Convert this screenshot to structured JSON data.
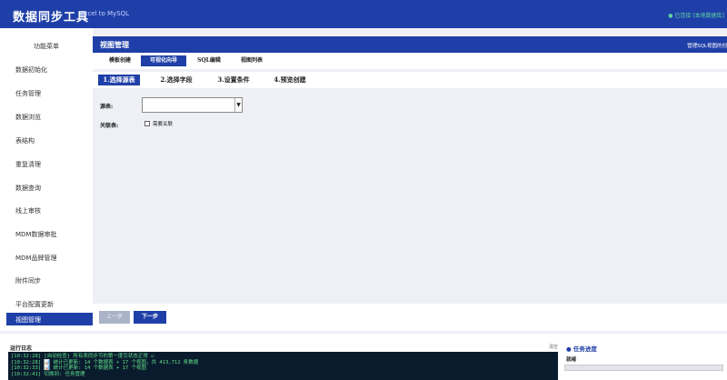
{
  "header": {
    "title": "数据同步工具",
    "subtitle": "Excel to MySQL",
    "connection_status": "● 已连接 [本地数据库]"
  },
  "sidebar": {
    "title": "功能菜单",
    "items": [
      {
        "label": "数据初始化"
      },
      {
        "label": "任务管理"
      },
      {
        "label": "数据浏览"
      },
      {
        "label": "表结构"
      },
      {
        "label": "重复清理"
      },
      {
        "label": "数据查询"
      },
      {
        "label": "线上审核"
      },
      {
        "label": "MDM数据审批"
      },
      {
        "label": "MDM品牌管理"
      },
      {
        "label": "附件同步"
      },
      {
        "label": "平台配置更新"
      },
      {
        "label": "视图管理"
      }
    ]
  },
  "main": {
    "title": "视图管理",
    "hint": "管理SQL视图的创",
    "tabs": [
      {
        "label": "模板创建"
      },
      {
        "label": "可视化向导"
      },
      {
        "label": "SQL编辑"
      },
      {
        "label": "视图列表"
      }
    ],
    "steps": [
      {
        "label": "1.选择源表"
      },
      {
        "label": "2.选择字段"
      },
      {
        "label": "3.设置条件"
      },
      {
        "label": "4.预览创建"
      }
    ],
    "form": {
      "source_label": "源表:",
      "source_value": "",
      "join_label": "关联表:",
      "join_checkbox_label": "需要关联"
    },
    "buttons": {
      "prev": "上一步",
      "next": "下一步"
    }
  },
  "log": {
    "title": "运行日志",
    "clear": "清空",
    "lines": [
      "[10:32:28] [自动检查] 所有表同步节的第一度引状态正常 ☑",
      "[10:32:28] 📊 统计已更新: 14 个数据表 + 17 个视图，共 413,712 条数据",
      "[10:32:33] 📊 统计已更新: 14 个数据表 + 17 个视图",
      "[10:32:41] 切换到: 任务管理"
    ]
  },
  "progress": {
    "title": "● 任务进度",
    "status": "就绪",
    "value_percent": 0
  },
  "colors": {
    "primary": "#1f3fa8",
    "log_bg": "#0b1b2e",
    "log_text": "#5fe08a",
    "status_ok": "#5fd3a0"
  }
}
